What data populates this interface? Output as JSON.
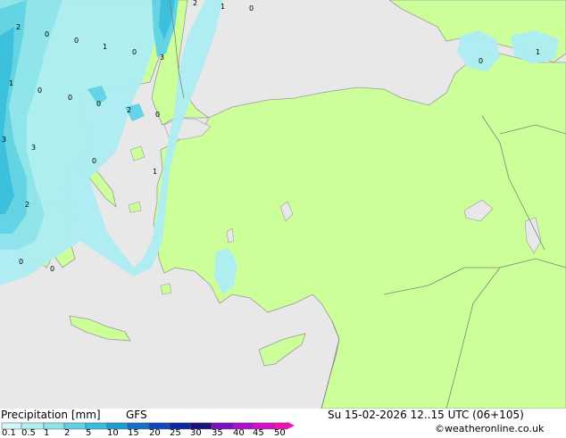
{
  "legend": {
    "title": "Precipitation [mm]",
    "model": "GFS",
    "ticks": [
      "0.1",
      "0.5",
      "1",
      "2",
      "5",
      "10",
      "15",
      "20",
      "25",
      "30",
      "35",
      "40",
      "45",
      "50"
    ],
    "colors": [
      "#d2f5f7",
      "#aeeef3",
      "#8ce4ee",
      "#5fd2e8",
      "#36bde0",
      "#1a9ed6",
      "#1571c8",
      "#1148b8",
      "#0c2aa0",
      "#1a127a",
      "#7a10c0",
      "#b010d0",
      "#d510c8",
      "#f010b8"
    ]
  },
  "run": {
    "datetime": "Su 15-02-2026 12..15 UTC (06+105)"
  },
  "credit": "©weatheronline.co.uk",
  "map_labels": [
    {
      "text": "2"
    },
    {
      "text": "0"
    },
    {
      "text": "1"
    },
    {
      "text": "0"
    },
    {
      "text": "2"
    },
    {
      "text": "0"
    },
    {
      "text": "0"
    },
    {
      "text": "1"
    },
    {
      "text": "0"
    },
    {
      "text": "3"
    },
    {
      "text": "1"
    },
    {
      "text": "0"
    },
    {
      "text": "0"
    },
    {
      "text": "2"
    },
    {
      "text": "0"
    },
    {
      "text": "3"
    },
    {
      "text": "3"
    },
    {
      "text": "0"
    },
    {
      "text": "1"
    },
    {
      "text": "2"
    },
    {
      "text": "0"
    },
    {
      "text": "0"
    },
    {
      "text": "0"
    },
    {
      "text": "1"
    }
  ],
  "colors": {
    "sea": "#e8e8e8",
    "land": "#ccff99",
    "coast": "#9a9a9a",
    "border": "#808080"
  }
}
